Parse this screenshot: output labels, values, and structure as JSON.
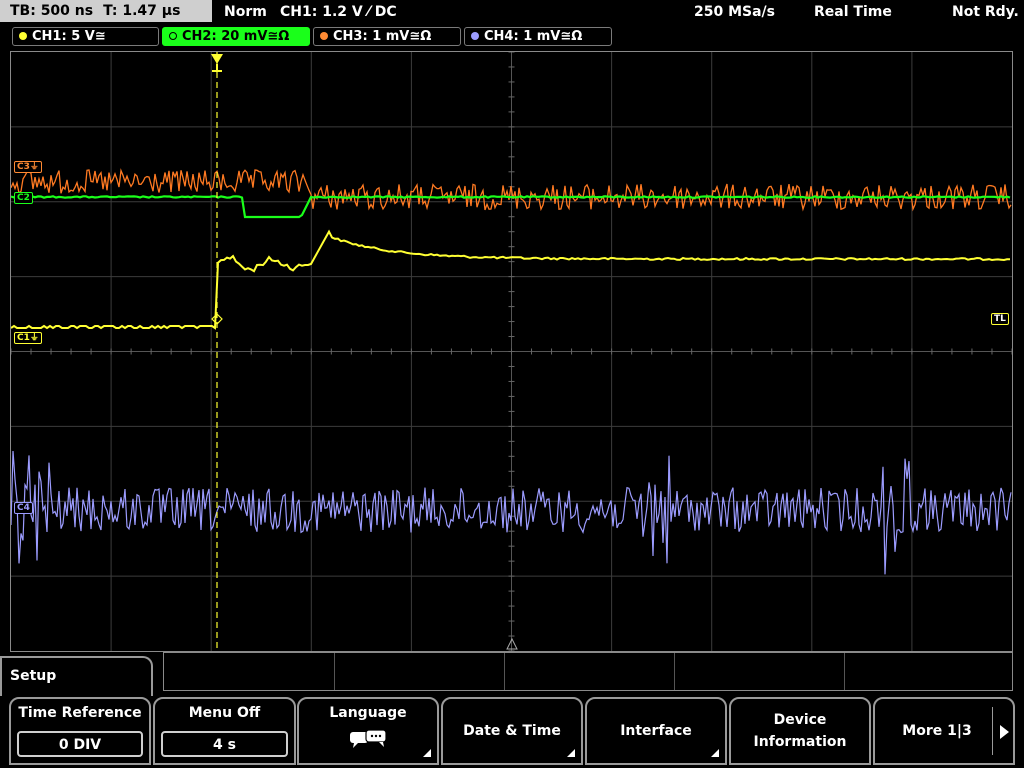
{
  "status": {
    "timebase": "TB: 500 ns",
    "trigger_time": "T: 1.47 µs",
    "mode": "Norm",
    "trigger": "CH1: 1.2 V ⁄ DC",
    "sample_rate": "250 MSa/s",
    "acquisition": "Real Time",
    "state": "Not Rdy."
  },
  "channels": [
    {
      "label": "CH1: 5 V≅",
      "color": "#ffff33"
    },
    {
      "label": "CH2: 20 mV≅Ω",
      "color": "#1aff1a"
    },
    {
      "label": "CH3: 1 mV≅Ω",
      "color": "#ff8a33"
    },
    {
      "label": "CH4: 1 mV≅Ω",
      "color": "#9c9cff"
    }
  ],
  "markers": {
    "c3": "C3",
    "c1": "C1",
    "c2": "C2",
    "c4": "C4",
    "trigger_level": "TL"
  },
  "menu": {
    "title": "Setup",
    "keys": [
      {
        "label": "Time Reference",
        "value": "0 DIV"
      },
      {
        "label": "Menu Off",
        "value": "4 s"
      },
      {
        "label": "Language",
        "icon": "speech-bubble-icon"
      },
      {
        "label": "Date & Time"
      },
      {
        "label": "Interface"
      },
      {
        "label": "Device Information"
      },
      {
        "label": "More 1|3"
      }
    ]
  }
}
